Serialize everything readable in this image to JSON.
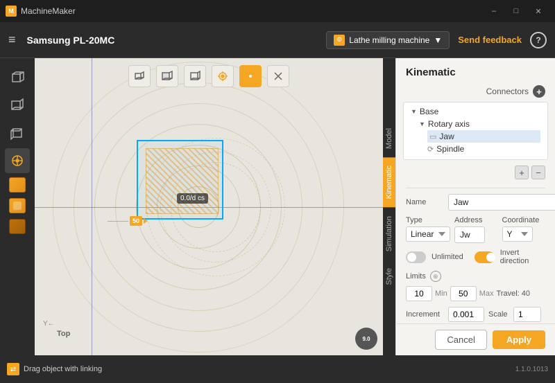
{
  "app": {
    "title": "MachineMaker",
    "machine_name": "Samsung PL-20MC",
    "machine_type": "Lathe milling machine",
    "send_feedback": "Send feedback",
    "help": "?",
    "version": "1.1.0.1013"
  },
  "titlebar": {
    "minimize": "–",
    "maximize": "□",
    "close": "✕"
  },
  "toolbar": {
    "menu_icon": "≡"
  },
  "canvas": {
    "tools": [
      {
        "id": "box",
        "icon": "⬜",
        "active": false
      },
      {
        "id": "box2",
        "icon": "⬛",
        "active": false
      },
      {
        "id": "box3",
        "icon": "◻",
        "active": false
      },
      {
        "id": "rotate",
        "icon": "⊕",
        "active": false
      },
      {
        "id": "dot",
        "icon": "⬤",
        "active": true
      },
      {
        "id": "cross",
        "icon": "✕",
        "active": false
      }
    ],
    "cs_label": "0.0/d cs",
    "arrow_label": "50",
    "top_label": "Top",
    "speed": "9.0"
  },
  "vtabs": [
    "Model",
    "Kinematic",
    "Simulation",
    "Style"
  ],
  "active_vtab": "Kinematic",
  "right_panel": {
    "title": "Kinematic",
    "connectors_label": "Connectors",
    "tree": {
      "base": "Base",
      "rotary_axis": "Rotary axis",
      "jaw": "Jaw",
      "spindle": "Spindle"
    },
    "name_label": "Name",
    "name_value": "Jaw",
    "type_label": "Type",
    "type_value": "Linear",
    "address_label": "Address",
    "address_value": "Jw",
    "coordinate_label": "Coordinate",
    "coordinate_value": "Y",
    "unlimited_label": "Unlimited",
    "invert_label": "Invert direction",
    "limits_label": "Limits",
    "limit_min_val": "10",
    "limit_min_label": "Min",
    "limit_max_val": "50",
    "limit_max_label": "Max",
    "travel_label": "Travel: 40",
    "increment_label": "Increment",
    "increment_value": "0.001",
    "scale_label": "Scale",
    "scale_value": "1",
    "cancel_btn": "Cancel",
    "apply_btn": "Apply"
  },
  "status": {
    "drag_text": "Drag object with linking"
  }
}
